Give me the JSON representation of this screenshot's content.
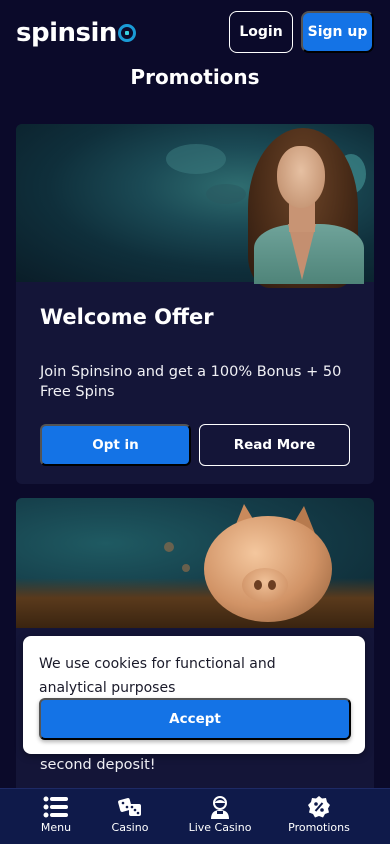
{
  "header": {
    "logo_text": "spinsin",
    "login_label": "Login",
    "signup_label": "Sign up"
  },
  "page": {
    "title": "Promotions"
  },
  "promotions": [
    {
      "title": "Welcome Offer",
      "description": "Join Spinsino and get a 100% Bonus + 50 Free Spins",
      "optin_label": "Opt in",
      "readmore_label": "Read More"
    },
    {
      "visible_text": "second deposit!"
    }
  ],
  "cookie_banner": {
    "message": "We use cookies for functional and analytical purposes",
    "accept_label": "Accept"
  },
  "bottom_nav": {
    "items": [
      {
        "label": "Menu",
        "icon": "menu-icon"
      },
      {
        "label": "Casino",
        "icon": "dice-icon"
      },
      {
        "label": "Live Casino",
        "icon": "dealer-icon"
      },
      {
        "label": "Promotions",
        "icon": "percent-badge-icon"
      }
    ]
  },
  "colors": {
    "background": "#0b0a2a",
    "card": "#141538",
    "accent": "#1473e6",
    "nav": "#0f1a4a"
  }
}
